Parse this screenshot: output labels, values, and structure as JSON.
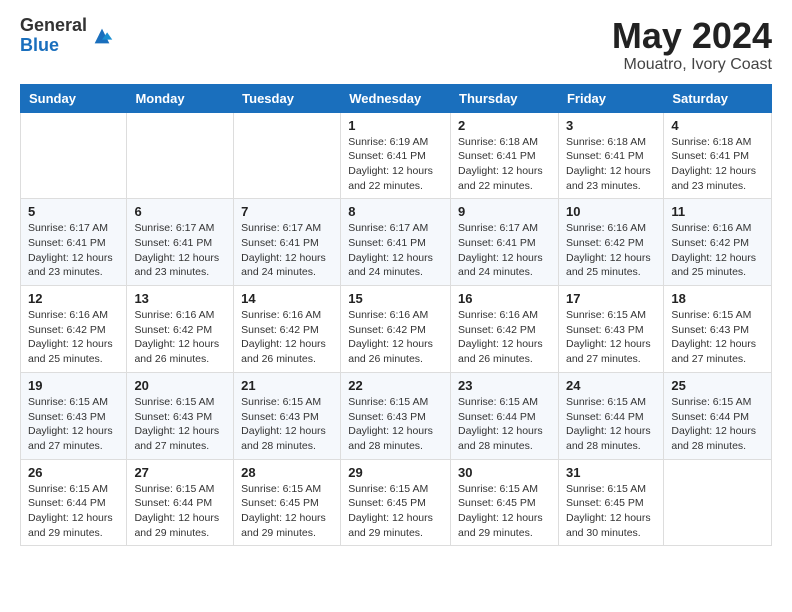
{
  "logo": {
    "general": "General",
    "blue": "Blue"
  },
  "title": {
    "month": "May 2024",
    "location": "Mouatro, Ivory Coast"
  },
  "weekdays": [
    "Sunday",
    "Monday",
    "Tuesday",
    "Wednesday",
    "Thursday",
    "Friday",
    "Saturday"
  ],
  "rows": [
    [
      null,
      null,
      null,
      {
        "date": "1",
        "sunrise": "6:19 AM",
        "sunset": "6:41 PM",
        "daylight": "12 hours and 22 minutes."
      },
      {
        "date": "2",
        "sunrise": "6:18 AM",
        "sunset": "6:41 PM",
        "daylight": "12 hours and 22 minutes."
      },
      {
        "date": "3",
        "sunrise": "6:18 AM",
        "sunset": "6:41 PM",
        "daylight": "12 hours and 23 minutes."
      },
      {
        "date": "4",
        "sunrise": "6:18 AM",
        "sunset": "6:41 PM",
        "daylight": "12 hours and 23 minutes."
      }
    ],
    [
      {
        "date": "5",
        "sunrise": "6:17 AM",
        "sunset": "6:41 PM",
        "daylight": "12 hours and 23 minutes."
      },
      {
        "date": "6",
        "sunrise": "6:17 AM",
        "sunset": "6:41 PM",
        "daylight": "12 hours and 23 minutes."
      },
      {
        "date": "7",
        "sunrise": "6:17 AM",
        "sunset": "6:41 PM",
        "daylight": "12 hours and 24 minutes."
      },
      {
        "date": "8",
        "sunrise": "6:17 AM",
        "sunset": "6:41 PM",
        "daylight": "12 hours and 24 minutes."
      },
      {
        "date": "9",
        "sunrise": "6:17 AM",
        "sunset": "6:41 PM",
        "daylight": "12 hours and 24 minutes."
      },
      {
        "date": "10",
        "sunrise": "6:16 AM",
        "sunset": "6:42 PM",
        "daylight": "12 hours and 25 minutes."
      },
      {
        "date": "11",
        "sunrise": "6:16 AM",
        "sunset": "6:42 PM",
        "daylight": "12 hours and 25 minutes."
      }
    ],
    [
      {
        "date": "12",
        "sunrise": "6:16 AM",
        "sunset": "6:42 PM",
        "daylight": "12 hours and 25 minutes."
      },
      {
        "date": "13",
        "sunrise": "6:16 AM",
        "sunset": "6:42 PM",
        "daylight": "12 hours and 26 minutes."
      },
      {
        "date": "14",
        "sunrise": "6:16 AM",
        "sunset": "6:42 PM",
        "daylight": "12 hours and 26 minutes."
      },
      {
        "date": "15",
        "sunrise": "6:16 AM",
        "sunset": "6:42 PM",
        "daylight": "12 hours and 26 minutes."
      },
      {
        "date": "16",
        "sunrise": "6:16 AM",
        "sunset": "6:42 PM",
        "daylight": "12 hours and 26 minutes."
      },
      {
        "date": "17",
        "sunrise": "6:15 AM",
        "sunset": "6:43 PM",
        "daylight": "12 hours and 27 minutes."
      },
      {
        "date": "18",
        "sunrise": "6:15 AM",
        "sunset": "6:43 PM",
        "daylight": "12 hours and 27 minutes."
      }
    ],
    [
      {
        "date": "19",
        "sunrise": "6:15 AM",
        "sunset": "6:43 PM",
        "daylight": "12 hours and 27 minutes."
      },
      {
        "date": "20",
        "sunrise": "6:15 AM",
        "sunset": "6:43 PM",
        "daylight": "12 hours and 27 minutes."
      },
      {
        "date": "21",
        "sunrise": "6:15 AM",
        "sunset": "6:43 PM",
        "daylight": "12 hours and 28 minutes."
      },
      {
        "date": "22",
        "sunrise": "6:15 AM",
        "sunset": "6:43 PM",
        "daylight": "12 hours and 28 minutes."
      },
      {
        "date": "23",
        "sunrise": "6:15 AM",
        "sunset": "6:44 PM",
        "daylight": "12 hours and 28 minutes."
      },
      {
        "date": "24",
        "sunrise": "6:15 AM",
        "sunset": "6:44 PM",
        "daylight": "12 hours and 28 minutes."
      },
      {
        "date": "25",
        "sunrise": "6:15 AM",
        "sunset": "6:44 PM",
        "daylight": "12 hours and 28 minutes."
      }
    ],
    [
      {
        "date": "26",
        "sunrise": "6:15 AM",
        "sunset": "6:44 PM",
        "daylight": "12 hours and 29 minutes."
      },
      {
        "date": "27",
        "sunrise": "6:15 AM",
        "sunset": "6:44 PM",
        "daylight": "12 hours and 29 minutes."
      },
      {
        "date": "28",
        "sunrise": "6:15 AM",
        "sunset": "6:45 PM",
        "daylight": "12 hours and 29 minutes."
      },
      {
        "date": "29",
        "sunrise": "6:15 AM",
        "sunset": "6:45 PM",
        "daylight": "12 hours and 29 minutes."
      },
      {
        "date": "30",
        "sunrise": "6:15 AM",
        "sunset": "6:45 PM",
        "daylight": "12 hours and 29 minutes."
      },
      {
        "date": "31",
        "sunrise": "6:15 AM",
        "sunset": "6:45 PM",
        "daylight": "12 hours and 30 minutes."
      },
      null
    ]
  ],
  "cell_labels": {
    "sunrise": "Sunrise:",
    "sunset": "Sunset:",
    "daylight": "Daylight:"
  }
}
